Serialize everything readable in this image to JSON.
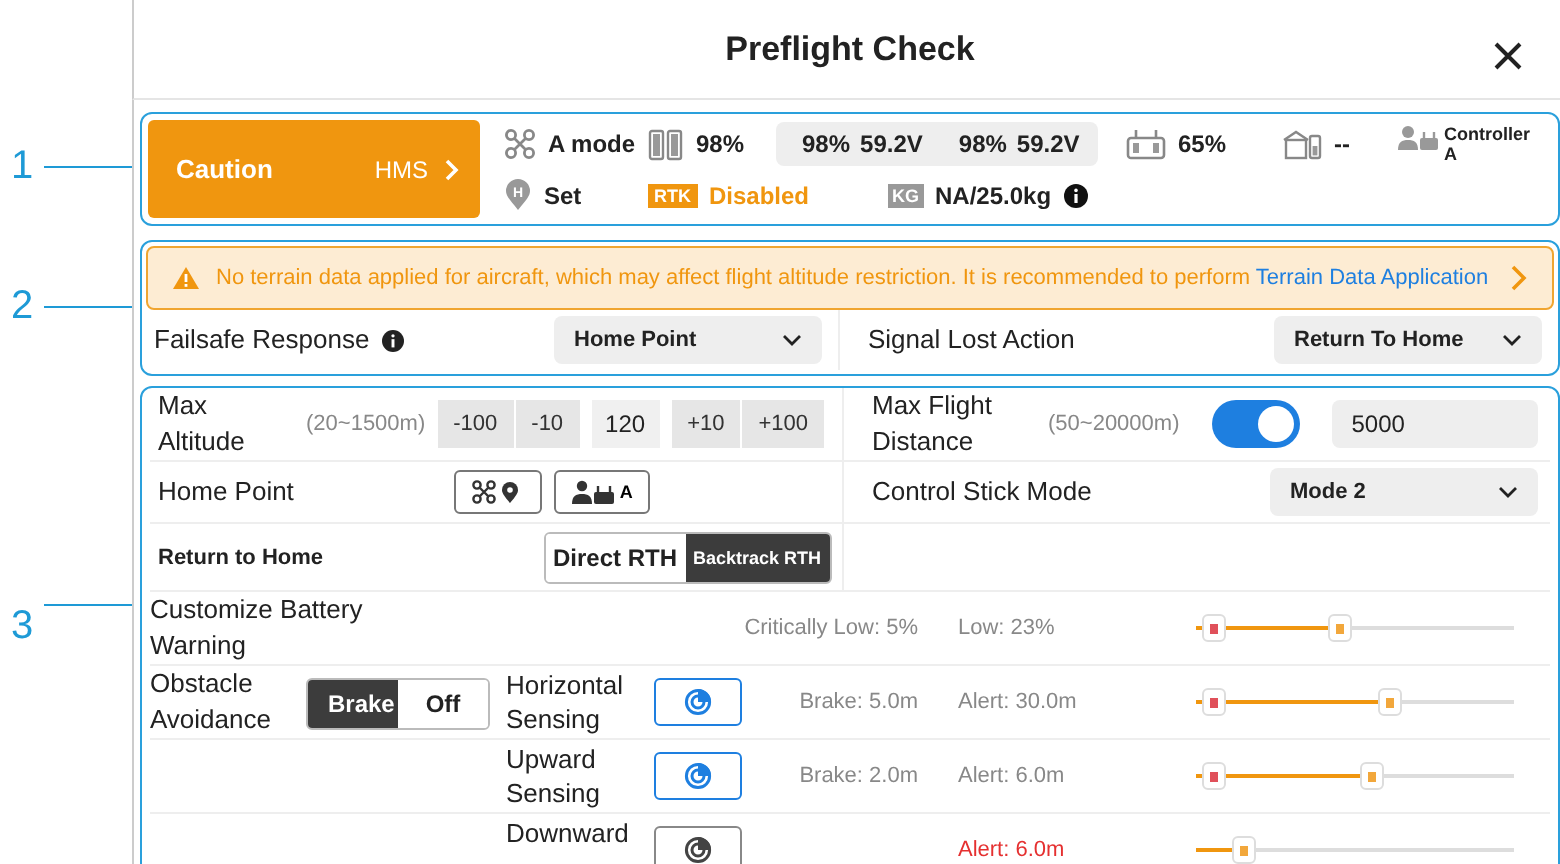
{
  "dialog": {
    "title": "Preflight Check"
  },
  "callouts": [
    "1",
    "2",
    "3"
  ],
  "status": {
    "alert": {
      "level": "Caution",
      "link": "HMS"
    },
    "row1": [
      {
        "kind": "drone",
        "text": "A mode"
      },
      {
        "kind": "battery",
        "text": "98%"
      },
      {
        "kind": "packs",
        "packs": [
          {
            "percent": "98%",
            "voltage": "59.2V"
          },
          {
            "percent": "98%",
            "voltage": "59.2V"
          }
        ]
      },
      {
        "kind": "rc",
        "text": "65%"
      },
      {
        "kind": "station",
        "text": "--"
      },
      {
        "kind": "controller",
        "text": "Controller A"
      }
    ],
    "row2": [
      {
        "kind": "home",
        "pin": "H",
        "text": "Set"
      },
      {
        "kind": "rtk",
        "badge": "RTK",
        "text": "Disabled"
      },
      {
        "kind": "payload",
        "badge": "KG",
        "text": "NA/25.0kg"
      }
    ]
  },
  "warning": {
    "text": "No terrain data applied for aircraft, which may affect flight altitude restriction. It is recommended to perform ",
    "link": "Terrain Data Application"
  },
  "failsafe": {
    "label": "Failsafe Response",
    "value": "Home Point"
  },
  "signal_lost": {
    "label": "Signal Lost Action",
    "value": "Return To Home"
  },
  "max_altitude": {
    "label": "Max Altitude",
    "range": "(20~1500m)",
    "minus": [
      "-100",
      "-10"
    ],
    "value": "120",
    "plus": [
      "+10",
      "+100"
    ]
  },
  "max_distance": {
    "label": "Max Flight Distance",
    "range": "(50~20000m)",
    "on": true,
    "value": "5000"
  },
  "home_point": {
    "label": "Home Point",
    "controller_letter": "A"
  },
  "stick_mode": {
    "label": "Control Stick Mode",
    "value": "Mode 2"
  },
  "rth": {
    "label": "Return to Home",
    "options": [
      {
        "label": "Direct RTH",
        "selected": false
      },
      {
        "label": "Backtrack RTH",
        "selected": true
      }
    ]
  },
  "battery_warning": {
    "label": "Customize Battery Warning",
    "critical": "Critically Low:  5%",
    "low": "Low: 23%",
    "thumbs": [
      {
        "level": 0.02,
        "color": "#e0505a"
      },
      {
        "level": 0.45,
        "color": "#f2a73b"
      }
    ]
  },
  "obstacle": {
    "label": "Obstacle Avoidance",
    "options": [
      {
        "label": "Brake",
        "selected": true
      },
      {
        "label": "Off",
        "selected": false
      }
    ],
    "sensors": [
      {
        "label": "Horizontal Sensing",
        "on": true,
        "brake": "Brake: 5.0m",
        "alert": "Alert: 30.0m",
        "alert_warning": false,
        "thumbs": [
          {
            "level": 0.02,
            "color": "#e0505a"
          },
          {
            "level": 0.62,
            "color": "#f2a73b"
          }
        ]
      },
      {
        "label": "Upward Sensing",
        "on": true,
        "brake": "Brake: 2.0m",
        "alert": "Alert: 6.0m",
        "alert_warning": false,
        "thumbs": [
          {
            "level": 0.02,
            "color": "#e0505a"
          },
          {
            "level": 0.56,
            "color": "#f2a73b"
          }
        ]
      },
      {
        "label": "Downward",
        "on": false,
        "alert": "Alert: 6.0m",
        "alert_warning": true,
        "thumbs": [
          {
            "level": 0.12,
            "color": "#f2a73b"
          }
        ]
      }
    ]
  }
}
